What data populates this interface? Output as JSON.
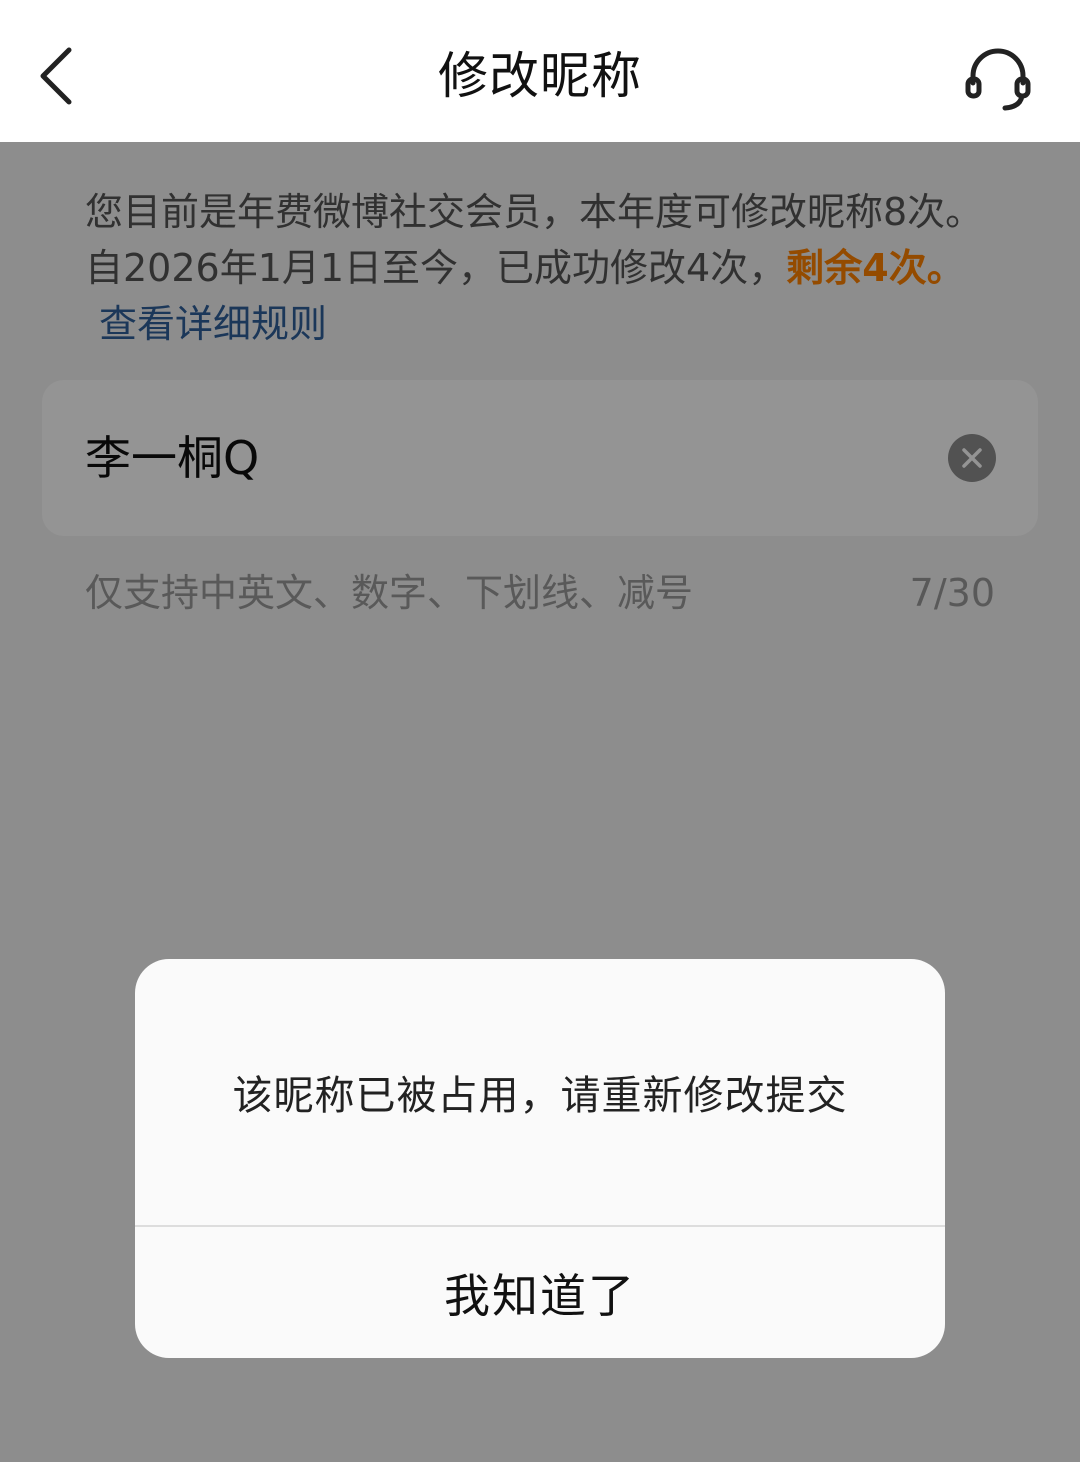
{
  "header": {
    "title": "修改昵称",
    "back_icon": "chevron-left-icon",
    "support_icon": "headset-icon"
  },
  "notice": {
    "text": "您目前是年费微博社交会员，本年度可修改昵称8次。自2026年1月1日至今，已成功修改4次，",
    "remaining": "剩余4次。",
    "rule_link": "查看详细规则",
    "highlight_color": "#ff8200",
    "link_color": "#2f5f9a"
  },
  "nickname_input": {
    "value": "李一桐Q",
    "clear_icon": "clear-icon"
  },
  "hint": {
    "text": "仅支持中英文、数字、下划线、减号",
    "counter": "7/30"
  },
  "dialog": {
    "message": "该昵称已被占用，请重新修改提交",
    "confirm_label": "我知道了"
  }
}
